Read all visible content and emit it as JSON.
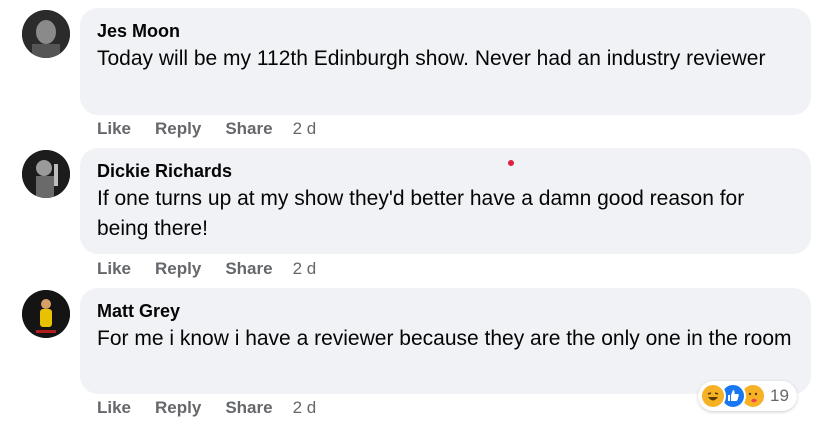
{
  "comments": [
    {
      "author": "Jes Moon",
      "text": "Today will be my 112th Edinburgh show. Never had an industry reviewer",
      "actions": {
        "like": "Like",
        "reply": "Reply",
        "share": "Share",
        "time": "2 d"
      }
    },
    {
      "author": "Dickie Richards",
      "text": "If one turns up at my show they'd better have a damn good reason for being there!",
      "actions": {
        "like": "Like",
        "reply": "Reply",
        "share": "Share",
        "time": "2 d"
      }
    },
    {
      "author": "Matt Grey",
      "text": "For me i know i have a reviewer because they are the only one in the room",
      "actions": {
        "like": "Like",
        "reply": "Reply",
        "share": "Share",
        "time": "2 d"
      },
      "reactions": {
        "icons": [
          "haha-icon",
          "like-icon",
          "care-icon"
        ],
        "count": "19"
      }
    }
  ],
  "colors": {
    "bubble": "#f0f2f5",
    "meta": "#65676b",
    "like_blue": "#1877f2",
    "notif_dot": "#e41e3f"
  }
}
